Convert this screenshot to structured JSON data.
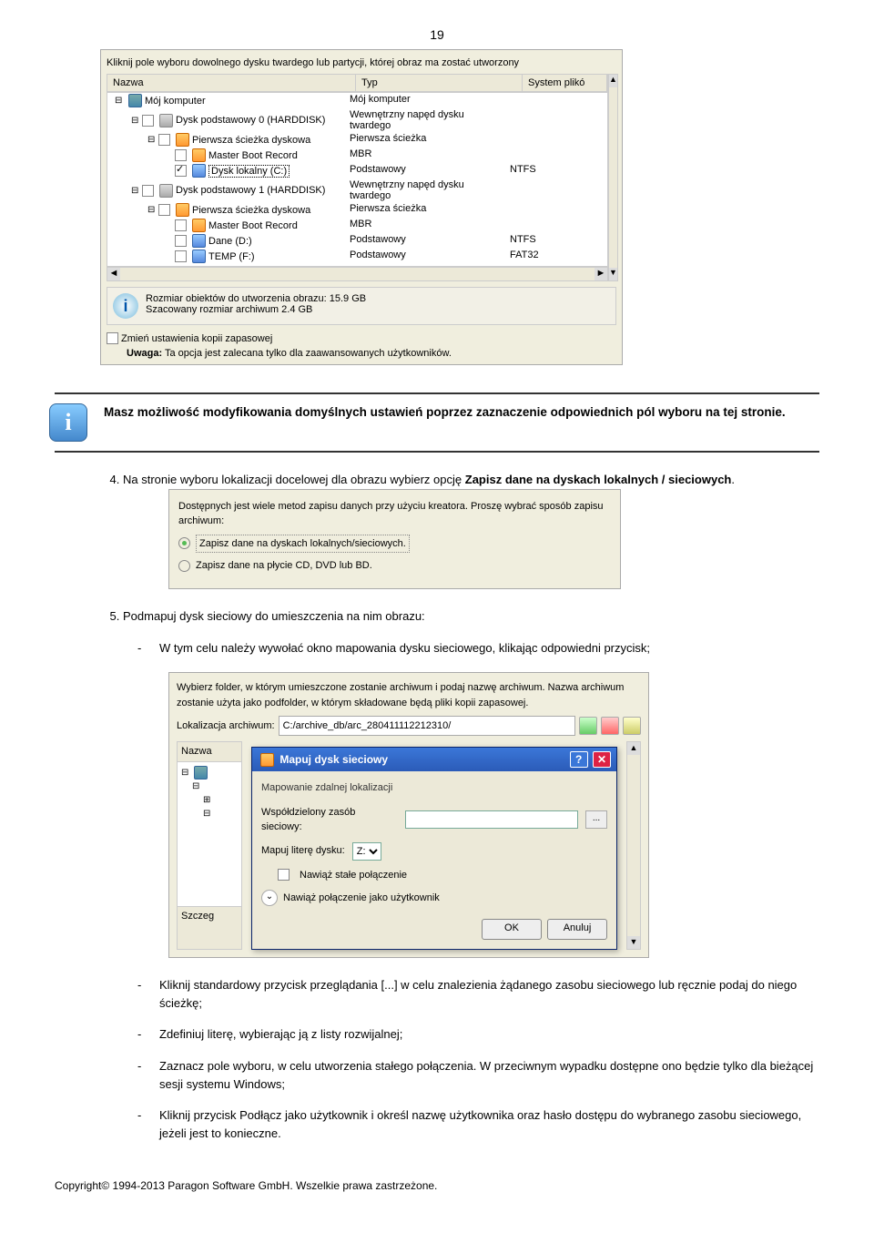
{
  "page_number": "19",
  "shot1": {
    "instruction": "Kliknij pole wyboru dowolnego dysku twardego lub partycji, której obraz ma zostać utworzony",
    "col_name": "Nazwa",
    "col_type": "Typ",
    "col_sys": "System plikó",
    "rows": [
      {
        "indent": 0,
        "exp": "⊟",
        "checkbox": false,
        "icon": "comp",
        "name": "Mój komputer",
        "type": "Mój komputer",
        "sys": ""
      },
      {
        "indent": 1,
        "exp": "⊟",
        "checkbox": true,
        "icon": "disk",
        "name": "Dysk podstawowy 0 (HARDDISK)",
        "type": "Wewnętrzny napęd dysku twardego",
        "sys": ""
      },
      {
        "indent": 2,
        "exp": "⊟",
        "checkbox": true,
        "icon": "part",
        "name": "Pierwsza ścieżka dyskowa",
        "type": "Pierwsza ścieżka",
        "sys": ""
      },
      {
        "indent": 3,
        "exp": "",
        "checkbox": true,
        "icon": "part",
        "name": "Master Boot Record",
        "type": "MBR",
        "sys": ""
      },
      {
        "indent": 3,
        "exp": "",
        "checkbox": true,
        "checked": true,
        "icon": "vol",
        "name": "Dysk lokalny (C:)",
        "type": "Podstawowy",
        "sys": "NTFS",
        "selected": true
      },
      {
        "indent": 1,
        "exp": "⊟",
        "checkbox": true,
        "icon": "disk",
        "name": "Dysk podstawowy 1 (HARDDISK)",
        "type": "Wewnętrzny napęd dysku twardego",
        "sys": ""
      },
      {
        "indent": 2,
        "exp": "⊟",
        "checkbox": true,
        "icon": "part",
        "name": "Pierwsza ścieżka dyskowa",
        "type": "Pierwsza ścieżka",
        "sys": ""
      },
      {
        "indent": 3,
        "exp": "",
        "checkbox": true,
        "icon": "part",
        "name": "Master Boot Record",
        "type": "MBR",
        "sys": ""
      },
      {
        "indent": 3,
        "exp": "",
        "checkbox": true,
        "icon": "vol",
        "name": "Dane (D:)",
        "type": "Podstawowy",
        "sys": "NTFS"
      },
      {
        "indent": 3,
        "exp": "",
        "checkbox": true,
        "icon": "vol",
        "name": "TEMP (F:)",
        "type": "Podstawowy",
        "sys": "FAT32"
      }
    ],
    "info_line1": "Rozmiar obiektów do utworzenia obrazu: 15.9 GB",
    "info_line2": "Szacowany rozmiar archiwum 2.4 GB",
    "change_opt": "Zmień ustawienia kopii zapasowej",
    "warning_label": "Uwaga:",
    "warning_text": " Ta opcja jest zalecana tylko dla zaawansowanych użytkowników."
  },
  "info_block": {
    "text": "Masz możliwość modyfikowania domyślnych ustawień poprzez zaznaczenie odpowiednich pól wyboru na tej stronie."
  },
  "step4": {
    "text_before": "Na stronie wyboru lokalizacji docelowej dla obrazu wybierz opcję ",
    "bold": "Zapisz dane na dyskach lokalnych / sieciowych",
    "text_after": "."
  },
  "shot2": {
    "line1": "Dostępnych jest wiele metod zapisu danych przy użyciu kreatora. Proszę wybrać sposób zapisu archiwum:",
    "opt1": "Zapisz dane na dyskach lokalnych/sieciowych.",
    "opt2": "Zapisz dane na płycie CD, DVD lub BD."
  },
  "step5": {
    "text": "Podmapuj dysk sieciowy do umieszczenia na nim obrazu:",
    "bullet1": "W tym celu należy wywołać okno mapowania dysku sieciowego, klikając odpowiedni przycisk;"
  },
  "shot3": {
    "desc": "Wybierz folder, w którym umieszczone zostanie archiwum i podaj nazwę archiwum. Nazwa archiwum zostanie użyta jako podfolder, w którym składowane będą pliki kopii zapasowej.",
    "loc_label": "Lokalizacja archiwum:",
    "loc_value": "C:/archive_db/arc_280411112212310/",
    "tree_head": "Nazwa",
    "szczeg": "Szczeg",
    "dlg_title": "Mapuj dysk sieciowy",
    "dlg_group": "Mapowanie zdalnej lokalizacji",
    "dlg_share": "Współdzielony zasób sieciowy:",
    "dlg_letter": "Mapuj literę dysku:",
    "dlg_letter_val": "Z:",
    "dlg_perm": "Nawiąż stałe połączenie",
    "dlg_adv": "Nawiąż połączenie jako użytkownik",
    "btn_ok": "OK",
    "btn_cancel": "Anuluj"
  },
  "bullets": {
    "b2": "Kliknij standardowy przycisk przeglądania [...] w celu znalezienia żądanego zasobu sieciowego lub ręcznie podaj do niego ścieżkę;",
    "b3": "Zdefiniuj literę, wybierając ją z listy rozwijalnej;",
    "b4": "Zaznacz pole wyboru, w celu utworzenia stałego połączenia. W przeciwnym wypadku dostępne ono będzie tylko dla bieżącej sesji systemu Windows;",
    "b5": "Kliknij przycisk Podłącz jako użytkownik i określ nazwę użytkownika oraz hasło dostępu do wybranego zasobu sieciowego, jeżeli jest to konieczne."
  },
  "footer": "Copyright© 1994-2013 Paragon Software GmbH. Wszelkie prawa zastrzeżone."
}
